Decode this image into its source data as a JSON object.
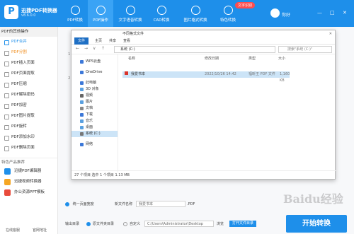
{
  "app": {
    "logo_letter": "P",
    "name": "迅捷PDF转换器",
    "version": "v8.6.0.0"
  },
  "top_tabs": [
    {
      "label": "PDF转换"
    },
    {
      "label": "PDF操作"
    },
    {
      "label": "文字语音转换"
    },
    {
      "label": "CAD转换"
    },
    {
      "label": "图片格式转换"
    },
    {
      "label": "特色转换"
    }
  ],
  "badge": "文字识别",
  "user": {
    "name": "你好"
  },
  "window_controls": [
    "—",
    "□",
    "✕"
  ],
  "sidebar": {
    "title": "PDF的其他操作",
    "items": [
      {
        "label": "PDF合并"
      },
      {
        "label": "PDF分割"
      },
      {
        "label": "PDF插入页面"
      },
      {
        "label": "PDF页面提取"
      },
      {
        "label": "PDF压缩"
      },
      {
        "label": "PDF解除密码"
      },
      {
        "label": "PDF加密"
      },
      {
        "label": "PDF图片提取"
      },
      {
        "label": "PDF旋转"
      },
      {
        "label": "PDF添加水印"
      },
      {
        "label": "PDF删除页面"
      }
    ],
    "products_title": "特色产品推荐",
    "products": [
      {
        "label": "迅捷PDF编辑器",
        "color": "#1e8fea"
      },
      {
        "label": "迅捷视频转换器",
        "color": "#f5a623"
      },
      {
        "label": "办公资源PPT模板",
        "color": "#e94b3c"
      }
    ],
    "footer_left": "在线客服",
    "footer_right": "官网地址"
  },
  "dialog": {
    "title": "不同格式文件",
    "ribbon_tabs": [
      "文件",
      "主页",
      "共享",
      "查看"
    ],
    "address": "系统 (C:)",
    "search_placeholder": "搜索\"系统 (C:)\"",
    "tree": [
      {
        "label": "WPS云盘",
        "color": "#3c78d8"
      },
      {
        "label": "OneDrive",
        "color": "#3c78d8"
      },
      {
        "label": "此电脑",
        "color": "#3c78d8"
      },
      {
        "label": "3D 对象",
        "color": "#5aa0e0"
      },
      {
        "label": "视频",
        "color": "#666"
      },
      {
        "label": "图片",
        "color": "#5aa0e0"
      },
      {
        "label": "文档",
        "color": "#888"
      },
      {
        "label": "下载",
        "color": "#3c78d8"
      },
      {
        "label": "音乐",
        "color": "#5aa0e0"
      },
      {
        "label": "桌面",
        "color": "#5aa0e0"
      },
      {
        "label": "系统 (C:)",
        "color": "#777"
      },
      {
        "label": "网络",
        "color": "#3c78d8"
      }
    ],
    "columns": [
      "名称",
      "修改日期",
      "类型",
      "大小"
    ],
    "file": {
      "name": "我爱书本",
      "date": "2022/10/26 14:42",
      "type": "福昕王 PDF 文件",
      "size": "1,160 KB"
    },
    "status": "27 个项目    选中 1 个项目  1.13 MB"
  },
  "behind_text": {
    "a": "1",
    "b": "2"
  },
  "output": {
    "merge_label": "统一页面宽度",
    "name_label": "新文件名称",
    "name_value": "我爱书本",
    "ext": ".PDF",
    "dir_label": "输出目录",
    "radio_original": "原文件夹目录",
    "radio_custom": "自定义",
    "path": "C:\\Users\\Administrator\\Desktop",
    "browse": "浏览",
    "open_btn": "打开文件目录"
  },
  "start_btn": "开始转换",
  "watermark": "Baidu经验"
}
